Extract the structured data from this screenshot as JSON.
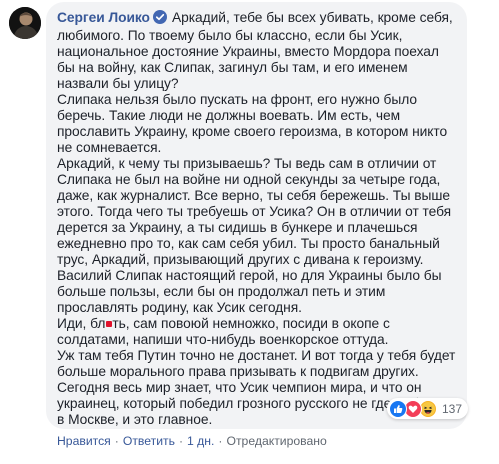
{
  "comment": {
    "author": "Сергеи Лоико",
    "verified_icon": "verified-badge-icon",
    "p1": "Аркадий, тебе бы всех убивать, кроме себя, любимого. По твоему было бы классно, если бы Усик, национальное достояние Украины, вместо Мордора поехал бы на войну, как Слипак, загинул бы там, и его именем назвали бы улицу?",
    "p2": "Слипака нельзя было пускать на фронт, его нужно было беречь. Такие люди не должны воевать. Им есть, чем прославить Украину, кроме своего героизма, в котором никто не сомневается.",
    "p3": "Аркадий, к чему ты призываешь? Ты ведь сам в отличии от Слипака не был на войне ни одной секунды за четыре года, даже, как журналист. Все верно, ты себя бережешь. Ты выше этого. Тогда чего ты требуешь от Усика? Он в отличии от тебя дерется за Украину, а ты сидишь в бункере и плачешься ежедневно про то, как сам себя убил. Ты просто банальный трус, Аркадий, призывающий других с дивана к героизму. Василий Слипак настоящий герой, но для Украины было бы больше пользы, если бы он продолжал петь и этим прославлять родину, как Усик сегодня.",
    "p4_before": "Иди, бл",
    "p4_after": "ть, сам повоюй немножко, посиди в окопе с солдатами, напиши что-нибудь военкорское оттуда.",
    "p5": "Уж там тебя Путин точно не достанет. И вот тогда у тебя будет больше морального права призывать к подвигам других.",
    "p6": "Сегодня весь мир знает, что Усик чемпион мира, и что он украинец, который победил грозного русского не где-нибудь а в Москве, и это главное."
  },
  "actions": {
    "like": "Нравится",
    "reply": "Ответить",
    "time": "1 дн.",
    "edited": "Отредактировано",
    "separator": "·"
  },
  "reactions": {
    "icons": [
      "like-icon",
      "love-icon",
      "haha-icon"
    ],
    "count": "137"
  },
  "colors": {
    "author": "#385898",
    "text": "#1d2129",
    "bubble_bg": "#f2f3f5",
    "meta": "#606770",
    "like": "#1877f2",
    "love": "#f33e58",
    "haha": "#f7b125"
  }
}
